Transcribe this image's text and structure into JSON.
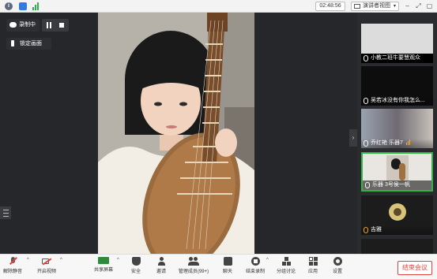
{
  "topbar": {
    "timer": "02:48:56",
    "view_label": "演讲者视图"
  },
  "recording": {
    "status_label": "录制中",
    "lock_label": "锁定画面"
  },
  "participants": [
    {
      "name": "小教二班牛要慧观众"
    },
    {
      "name": "吴若冰没有你我怎么..."
    },
    {
      "name": "乔红艳 乐器7"
    },
    {
      "name": "乐器 3号侯一帆"
    },
    {
      "name": "吉雅"
    }
  ],
  "toolbar": {
    "mute_label": "解除静音",
    "video_label": "开启视频",
    "share_label": "共享屏幕",
    "security_label": "安全",
    "invite_label": "邀请",
    "members_label": "管理成员(99+)",
    "chat_label": "聊天",
    "record_label": "结束录制",
    "breakout_label": "分组讨论",
    "apps_label": "应用",
    "settings_label": "设置",
    "end_label": "结束会议"
  },
  "colors": {
    "accent_green": "#35b24a",
    "end_red": "#e0443e",
    "mute_red": "#e0443e",
    "share_green": "#2e8b3a"
  },
  "icons": [
    "info-icon",
    "shield-icon",
    "signal-icon",
    "speaker-view-icon",
    "minimize-icon",
    "fullscreen-icon",
    "close-icon",
    "cloud-icon",
    "pause-icon",
    "stop-icon",
    "pin-icon",
    "menu-icon",
    "chevron-right-icon",
    "mic-off-icon",
    "video-off-icon",
    "share-screen-icon",
    "security-icon",
    "invite-icon",
    "members-icon",
    "chat-icon",
    "record-stop-icon",
    "breakout-icon",
    "apps-icon",
    "settings-icon"
  ]
}
